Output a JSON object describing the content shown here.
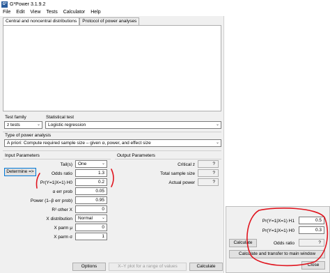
{
  "window": {
    "title": "G*Power 3.1.9.2",
    "icon_label": "G*"
  },
  "menu": [
    "File",
    "Edit",
    "View",
    "Tests",
    "Calculator",
    "Help"
  ],
  "tabs": [
    {
      "label": "Central and noncentral distributions",
      "active": true
    },
    {
      "label": "Protocol of power analyses",
      "active": false
    }
  ],
  "test_family": {
    "label": "Test family",
    "value": "z tests"
  },
  "statistical_test": {
    "label": "Statistical test",
    "value": "Logistic regression"
  },
  "power_analysis": {
    "label": "Type of power analysis",
    "value": "A priori: Compute required sample size – given α, power, and effect size"
  },
  "input_parameters": {
    "title": "Input Parameters",
    "determine_label": "Determine =>",
    "rows": [
      {
        "label": "Tail(s)",
        "value": "One",
        "type": "select"
      },
      {
        "label": "Odds ratio",
        "value": "1.3",
        "type": "input"
      },
      {
        "label": "Pr(Y=1|X=1) H0",
        "value": "0.2",
        "type": "input"
      },
      {
        "label": "α err prob",
        "value": "0.05",
        "type": "input"
      },
      {
        "label": "Power (1–β err prob)",
        "value": "0.95",
        "type": "input"
      },
      {
        "label": "R² other X",
        "value": "0",
        "type": "input"
      },
      {
        "label": "X distribution",
        "value": "Normal",
        "type": "select"
      },
      {
        "label": "X parm μ",
        "value": "0",
        "type": "input"
      },
      {
        "label": "X parm σ",
        "value": "1",
        "type": "input"
      }
    ]
  },
  "output_parameters": {
    "title": "Output Parameters",
    "rows": [
      {
        "label": "Critical z",
        "value": "?"
      },
      {
        "label": "Total sample size",
        "value": "?"
      },
      {
        "label": "Actual power",
        "value": "?"
      }
    ]
  },
  "bottom_buttons": {
    "options": "Options",
    "xy_plot": "X–Y plot for a range of values",
    "calculate": "Calculate"
  },
  "dialog": {
    "rows": [
      {
        "label": "Pr(Y=1|X=1) H1",
        "value": "0.5"
      },
      {
        "label": "Pr(Y=1|X=1) H0",
        "value": "0.3"
      }
    ],
    "calculate_label": "Calculate",
    "odds_ratio_label": "Odds ratio",
    "odds_ratio_value": "?",
    "transfer_label": "Calculate and transfer to main window",
    "close_label": "Close"
  },
  "annotation_color": "#e0141e"
}
